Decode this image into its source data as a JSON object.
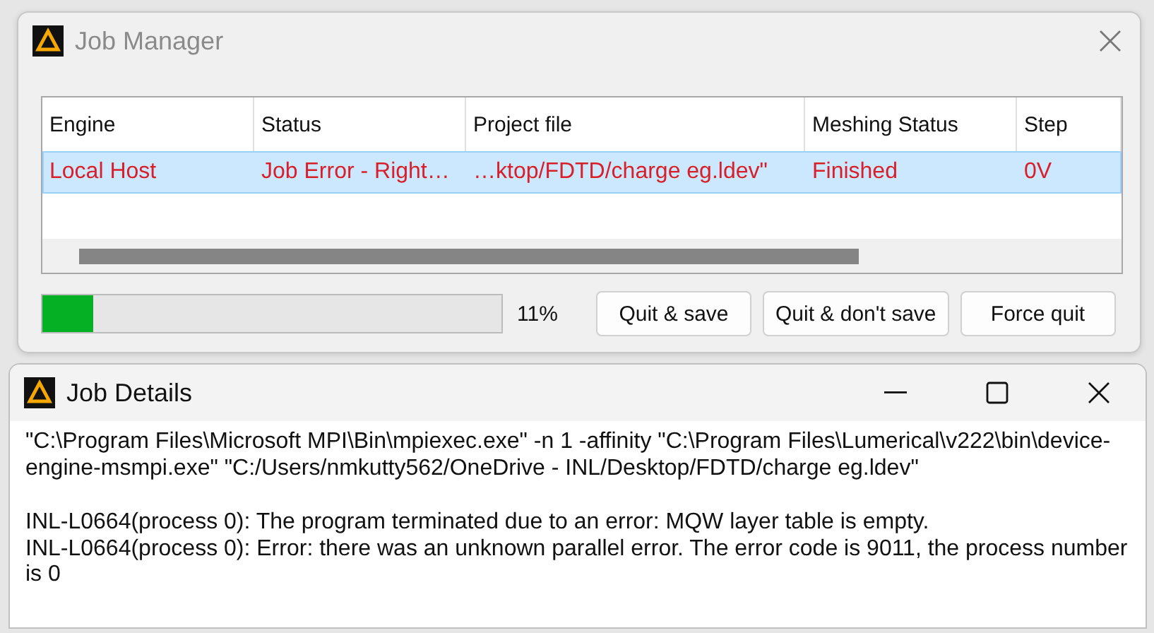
{
  "job_manager": {
    "title": "Job Manager",
    "table": {
      "columns": [
        "Engine",
        "Status",
        "Project file",
        "Meshing Status",
        "Step"
      ],
      "rows": [
        {
          "selected": true,
          "error": true,
          "cells": [
            "Local Host",
            "Job Error - Right…",
            "…ktop/FDTD/charge eg.ldev\"",
            "Finished",
            "0V"
          ]
        }
      ]
    },
    "progress": {
      "level": 0.11,
      "reading": "11%"
    },
    "buttons": [
      "Quit & save",
      "Quit & don't save",
      "Force quit"
    ]
  },
  "job_details": {
    "title": "Job Details",
    "paragraphs": [
      "\"C:\\Program Files\\Microsoft MPI\\Bin\\mpiexec.exe\" -n 1 -affinity \"C:\\Program Files\\Lumerical\\v222\\bin\\device-engine-msmpi.exe\" \"C:/Users/nmkutty562/OneDrive - INL/Desktop/FDTD/charge eg.ldev\"",
      "INL-L0664(process 0): The program terminated due to an error: MQW layer table is empty.\nINL-L0664(process 0): Error: there was an unknown parallel error. The error code is 9011, the process number is 0"
    ]
  }
}
